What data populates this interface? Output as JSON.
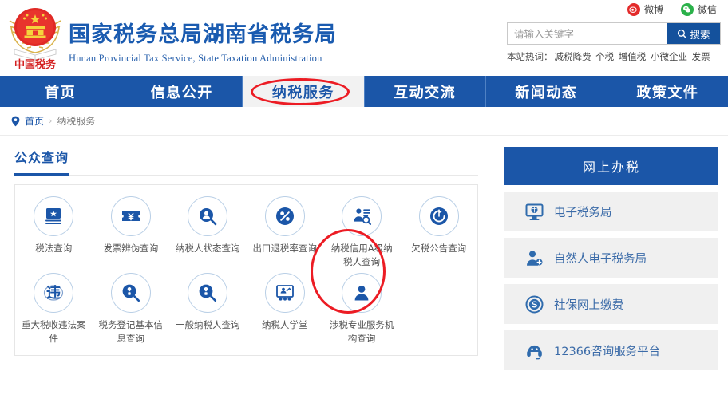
{
  "header": {
    "logo_alt": "china-taxation-emblem",
    "title_cn": "国家税务总局湖南省税务局",
    "title_en": "Hunan Provincial  Tax Service, State Taxation Administration",
    "social": [
      {
        "label": "微博",
        "icon": "weibo-icon",
        "color": "#e32b2b"
      },
      {
        "label": "微信",
        "icon": "wechat-icon",
        "color": "#2bb14a"
      }
    ],
    "search": {
      "placeholder": "请输入关键字",
      "value": "",
      "button_label": "搜索",
      "button_icon": "search-icon",
      "button_color": "#14519c"
    },
    "hotwords": {
      "label": "本站热词：",
      "items": [
        "减税降费",
        "个税",
        "增值税",
        "小微企业",
        "发票"
      ]
    }
  },
  "nav": {
    "items": [
      {
        "label": "首页",
        "active": false
      },
      {
        "label": "信息公开",
        "active": false
      },
      {
        "label": "纳税服务",
        "active": true
      },
      {
        "label": "互动交流",
        "active": false
      },
      {
        "label": "新闻动态",
        "active": false
      },
      {
        "label": "政策文件",
        "active": false
      }
    ],
    "active_color": "#1b56a8",
    "bar_color": "#1b56a8"
  },
  "breadcrumb": {
    "pin_icon": "location-pin-icon",
    "home": "首页",
    "separator": "›",
    "current": "纳税服务"
  },
  "main": {
    "panel_title": "公众查询",
    "tiles": [
      {
        "label": "税法查询",
        "icon": "book-star-icon"
      },
      {
        "label": "发票辨伪查询",
        "icon": "invoice-yuan-icon"
      },
      {
        "label": "纳税人状态查询",
        "icon": "taxpayer-status-search-icon"
      },
      {
        "label": "出口退税率查询",
        "icon": "percent-icon"
      },
      {
        "label": "纳税信用A级纳税人查询",
        "icon": "credit-rating-search-icon",
        "highlighted": true
      },
      {
        "label": "欠税公告查询",
        "icon": "target-clock-icon"
      },
      {
        "label": "重大税收违法案件",
        "icon": "violation-icon"
      },
      {
        "label": "税务登记基本信息查询",
        "icon": "registration-search-icon"
      },
      {
        "label": "一般纳税人查询",
        "icon": "general-taxpayer-search-icon"
      },
      {
        "label": "纳税人学堂",
        "icon": "classroom-icon"
      },
      {
        "label": "涉税专业服务机构查询",
        "icon": "person-icon"
      }
    ]
  },
  "sidebar": {
    "header": "网上办税",
    "items": [
      {
        "label": "电子税务局",
        "icon": "monitor-icon"
      },
      {
        "label": "自然人电子税务局",
        "icon": "person-plus-icon"
      },
      {
        "label": "社保网上缴费",
        "icon": "social-security-icon"
      },
      {
        "label": "12366咨询服务平台",
        "icon": "headset-icon"
      }
    ]
  },
  "annotations": {
    "nav_circle": "纳税服务",
    "tile_circle": "纳税信用A级纳税人查询",
    "color": "#ec1c24"
  }
}
